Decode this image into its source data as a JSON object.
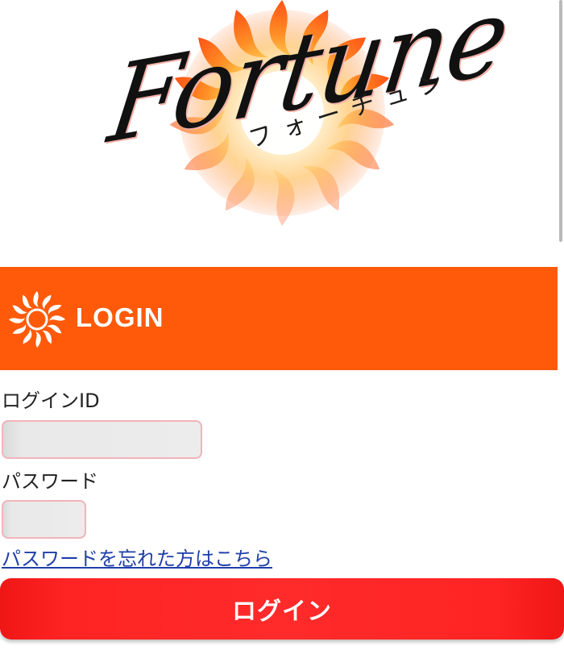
{
  "logo": {
    "script_text": "Fortune",
    "kana_text": "フォーチュン"
  },
  "banner": {
    "title": "LOGIN",
    "color": "#ff5a0a"
  },
  "form": {
    "id_label": "ログインID",
    "id_value": "",
    "password_label": "パスワード",
    "password_value": "",
    "forgot_link": "パスワードを忘れた方はこちら",
    "submit_label": "ログイン"
  },
  "colors": {
    "button": "#ff2424",
    "link": "#1f3fa8",
    "field_border": "#f2b3bb"
  }
}
